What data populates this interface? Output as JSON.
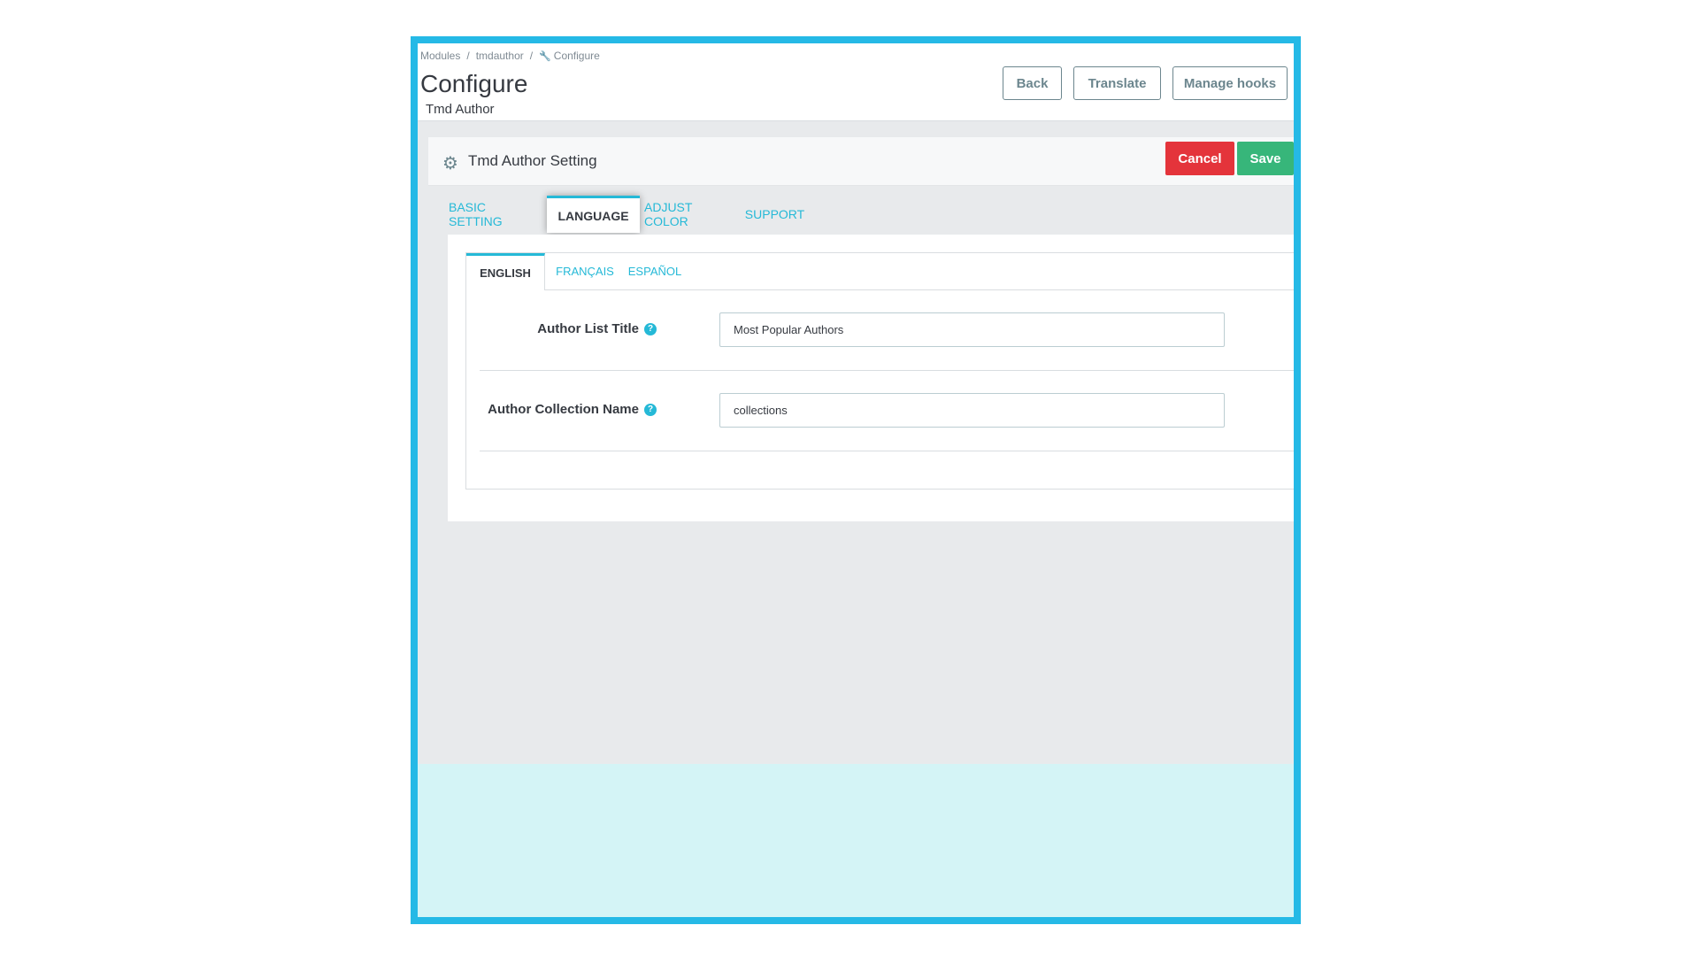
{
  "breadcrumb": {
    "items": [
      "Modules",
      "tmdauthor",
      "Configure"
    ],
    "separator": "/"
  },
  "header": {
    "title": "Configure",
    "subtitle": "Tmd Author",
    "buttons": {
      "back": "Back",
      "translate": "Translate",
      "manage_hooks": "Manage hooks"
    }
  },
  "panel": {
    "title": "Tmd Author Setting",
    "icon": "gears-icon",
    "cancel_label": "Cancel",
    "save_label": "Save"
  },
  "tabs": [
    {
      "label": "BASIC SETTING",
      "active": false
    },
    {
      "label": "LANGUAGE",
      "active": true
    },
    {
      "label": "ADJUST COLOR",
      "active": false
    },
    {
      "label": "SUPPORT",
      "active": false
    }
  ],
  "language_tabs": [
    {
      "label": "ENGLISH",
      "active": true
    },
    {
      "label": "FRANÇAIS",
      "active": false
    },
    {
      "label": "ESPAÑOL",
      "active": false
    }
  ],
  "form": {
    "author_list_title": {
      "label": "Author List Title",
      "value": "Most Popular Authors"
    },
    "author_collection_name": {
      "label": "Author Collection Name",
      "value": "collections"
    },
    "help_glyph": "?"
  },
  "colors": {
    "frame_border": "#25b9e6",
    "accent": "#25b9d7",
    "cancel": "#e4343b",
    "save": "#37b67a",
    "bottom_band": "#d4f4f6"
  }
}
